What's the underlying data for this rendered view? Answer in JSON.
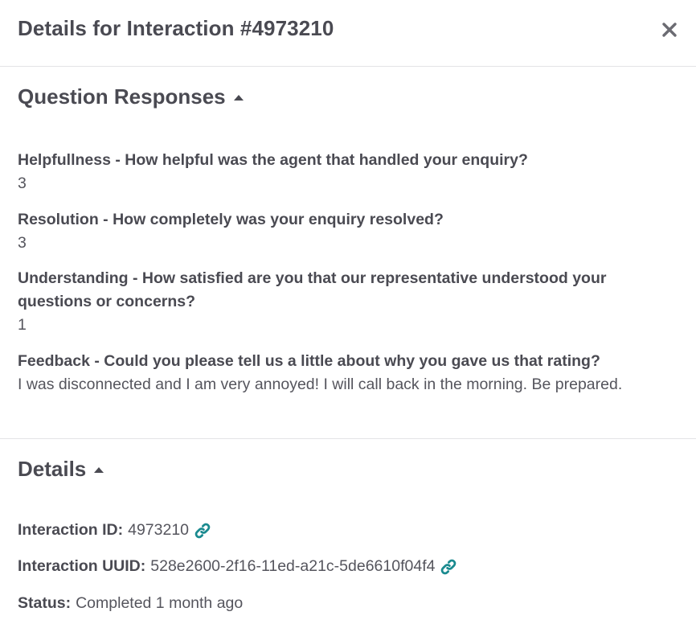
{
  "header": {
    "title": "Details for Interaction #4973210",
    "close_icon": "close-icon"
  },
  "questions_section": {
    "heading": "Question Responses",
    "caret_icon": "caret-up-icon",
    "items": [
      {
        "question": "Helpfullness - How helpful was the agent that handled your enquiry?",
        "answer": "3"
      },
      {
        "question": "Resolution - How completely was your enquiry resolved?",
        "answer": "3"
      },
      {
        "question": "Understanding - How satisfied are you that our representative understood your questions or concerns?",
        "answer": "1"
      },
      {
        "question": "Feedback - Could you please tell us a little about why you gave us that rating?",
        "answer": "I was disconnected and I am very annoyed! I will call back in the morning. Be prepared."
      }
    ]
  },
  "details_section": {
    "heading": "Details",
    "caret_icon": "caret-up-icon",
    "interaction_id": {
      "label": "Interaction ID:",
      "value": "4973210",
      "icon": "link-icon"
    },
    "interaction_uuid": {
      "label": "Interaction UUID:",
      "value": "528e2600-2f16-11ed-a21c-5de6610f04f4",
      "icon": "link-icon"
    },
    "status": {
      "label": "Status:",
      "value": "Completed 1 month ago"
    }
  },
  "colors": {
    "text_primary": "#4a4a52",
    "link_icon": "#1a8a8f",
    "divider": "#e3e3e6"
  }
}
